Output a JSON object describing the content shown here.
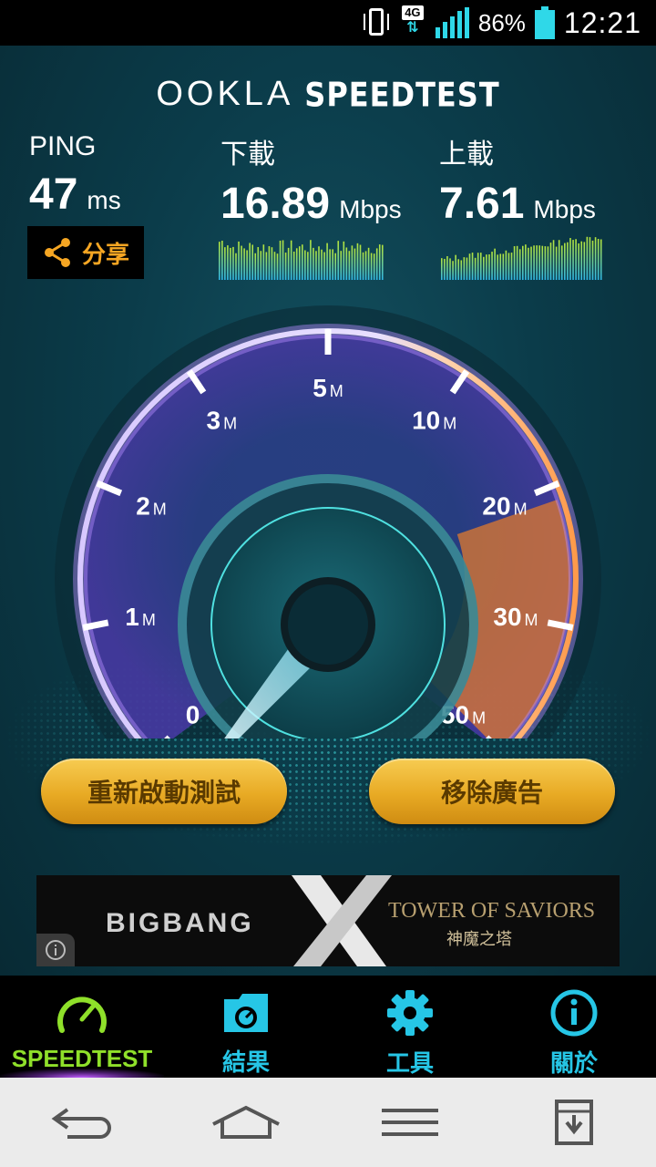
{
  "status_bar": {
    "network": "4G",
    "battery": "86%",
    "time": "12:21"
  },
  "header": {
    "brand": "OOKLA",
    "product": "SPEEDTEST"
  },
  "results": {
    "ping": {
      "label": "PING",
      "value": "47",
      "unit": "ms"
    },
    "download": {
      "label": "下載",
      "value": "16.89",
      "unit": "Mbps"
    },
    "upload": {
      "label": "上載",
      "value": "7.61",
      "unit": "Mbps"
    },
    "share_label": "分享"
  },
  "gauge": {
    "ticks": [
      {
        "num": "0",
        "suf": ""
      },
      {
        "num": "1",
        "suf": "M"
      },
      {
        "num": "2",
        "suf": "M"
      },
      {
        "num": "3",
        "suf": "M"
      },
      {
        "num": "5",
        "suf": "M"
      },
      {
        "num": "10",
        "suf": "M"
      },
      {
        "num": "20",
        "suf": "M"
      },
      {
        "num": "30",
        "suf": "M"
      },
      {
        "num": "50",
        "suf": "M"
      }
    ],
    "highlight_range": [
      "20",
      "50"
    ],
    "needle_value": 0
  },
  "buttons": {
    "restart": "重新啟動測試",
    "remove_ads": "移除廣告"
  },
  "ad": {
    "left": "BIGBANG",
    "mid": "X",
    "right": "TOWER OF SAVIORS",
    "right_sub": "神魔之塔"
  },
  "tabs": [
    {
      "label": "SPEEDTEST",
      "icon": "speedometer-icon"
    },
    {
      "label": "結果",
      "icon": "results-folder-icon"
    },
    {
      "label": "工具",
      "icon": "gear-icon"
    },
    {
      "label": "關於",
      "icon": "info-icon"
    }
  ],
  "colors": {
    "accent_green": "#8fe02a",
    "accent_cyan": "#26c6e6",
    "button_gold": "#e8aa24",
    "arc_orange": "#f08a3a",
    "arc_purple": "#9a6cf0"
  }
}
